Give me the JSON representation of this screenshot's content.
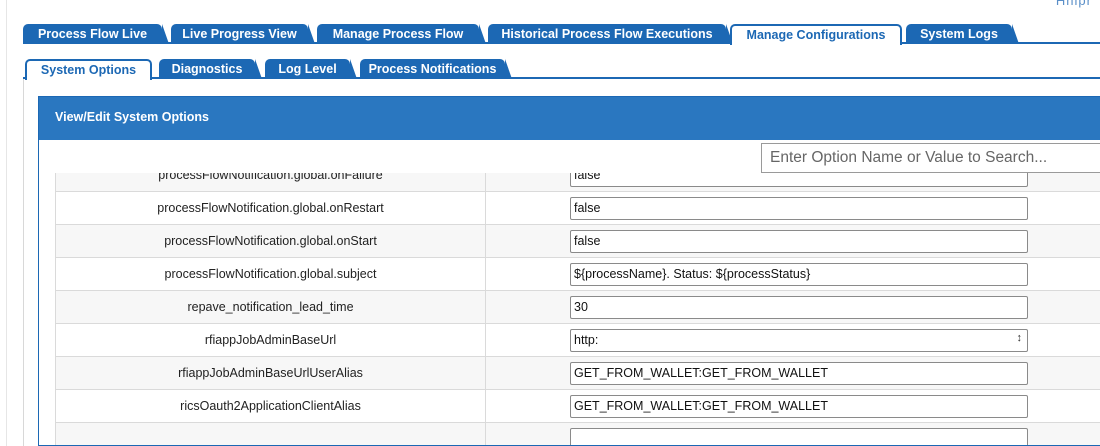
{
  "corner_text": "Hnipr",
  "main_tabs": [
    {
      "label": "Process Flow Live"
    },
    {
      "label": "Live Progress View"
    },
    {
      "label": "Manage Process Flow"
    },
    {
      "label": "Historical Process Flow Executions"
    },
    {
      "label": "Manage Configurations",
      "active": true
    },
    {
      "label": "System Logs"
    }
  ],
  "sub_tabs": [
    {
      "label": "System Options",
      "active": true
    },
    {
      "label": "Diagnostics"
    },
    {
      "label": "Log Level"
    },
    {
      "label": "Process Notifications"
    }
  ],
  "panel": {
    "title": "View/Edit System Options",
    "search_placeholder": "Enter Option Name or Value to Search..."
  },
  "options": [
    {
      "name": "processFlowNotification.global.onFailure",
      "value": "false"
    },
    {
      "name": "processFlowNotification.global.onRestart",
      "value": "false"
    },
    {
      "name": "processFlowNotification.global.onStart",
      "value": "false"
    },
    {
      "name": "processFlowNotification.global.subject",
      "value": "${processName}. Status: ${processStatus}"
    },
    {
      "name": "repave_notification_lead_time",
      "value": "30"
    },
    {
      "name": "rfiappJobAdminBaseUrl",
      "value": "http:",
      "spinner_icon": "resize-grip-icon"
    },
    {
      "name": "rfiappJobAdminBaseUrlUserAlias",
      "value": "GET_FROM_WALLET:GET_FROM_WALLET"
    },
    {
      "name": "ricsOauth2ApplicationClientAlias",
      "value": "GET_FROM_WALLET:GET_FROM_WALLET"
    },
    {
      "name": "",
      "value": ""
    }
  ]
}
